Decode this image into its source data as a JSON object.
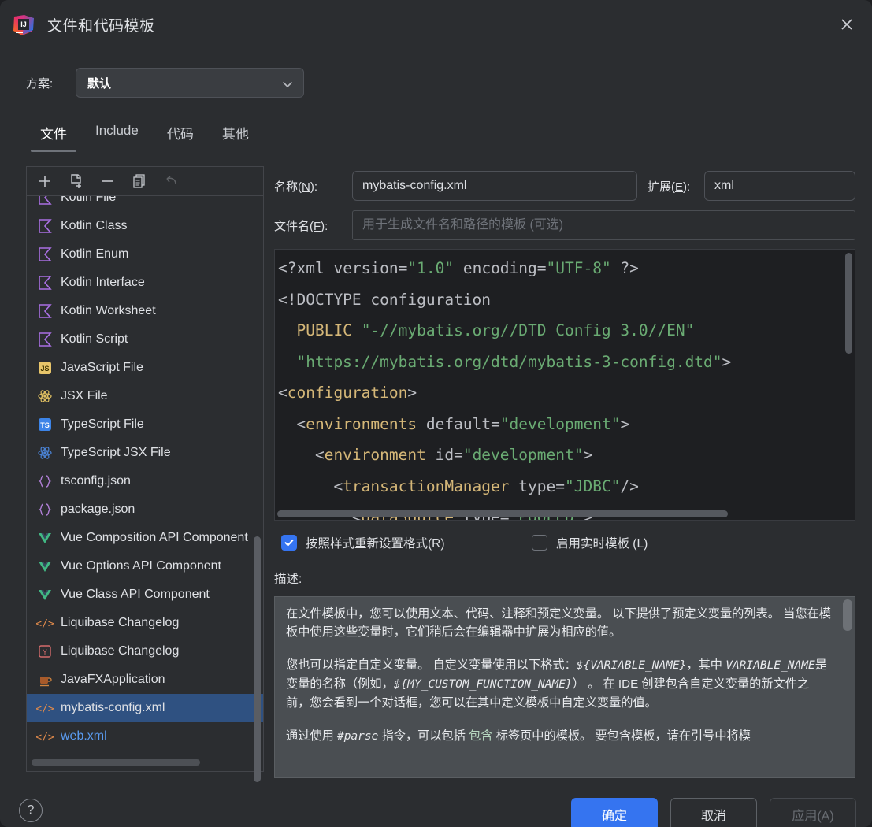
{
  "window": {
    "title": "文件和代码模板",
    "logo_icon": "intellij-idea-logo",
    "close_icon": "close-icon"
  },
  "scheme": {
    "label": "方案:",
    "value": "默认",
    "chevron_icon": "chevron-down-icon"
  },
  "tabs": [
    {
      "label": "文件",
      "active": true
    },
    {
      "label": "Include",
      "active": false
    },
    {
      "label": "代码",
      "active": false
    },
    {
      "label": "其他",
      "active": false
    }
  ],
  "list_toolbar": [
    {
      "name": "add-button",
      "icon": "plus-icon",
      "disabled": false
    },
    {
      "name": "create-template-button",
      "icon": "new-file-plus-icon",
      "disabled": false
    },
    {
      "name": "remove-button",
      "icon": "minus-icon",
      "disabled": false
    },
    {
      "name": "copy-button",
      "icon": "copy-icon",
      "disabled": false
    },
    {
      "name": "reset-button",
      "icon": "undo-icon",
      "disabled": true
    }
  ],
  "template_list": [
    {
      "label": "Kotlin File",
      "icon": "kotlin-icon",
      "selected": false,
      "modified": false
    },
    {
      "label": "Kotlin Class",
      "icon": "kotlin-icon",
      "selected": false,
      "modified": false
    },
    {
      "label": "Kotlin Enum",
      "icon": "kotlin-icon",
      "selected": false,
      "modified": false
    },
    {
      "label": "Kotlin Interface",
      "icon": "kotlin-icon",
      "selected": false,
      "modified": false
    },
    {
      "label": "Kotlin Worksheet",
      "icon": "kotlin-icon",
      "selected": false,
      "modified": false
    },
    {
      "label": "Kotlin Script",
      "icon": "kotlin-icon",
      "selected": false,
      "modified": false
    },
    {
      "label": "JavaScript File",
      "icon": "javascript-icon",
      "selected": false,
      "modified": false
    },
    {
      "label": "JSX File",
      "icon": "react-icon",
      "selected": false,
      "modified": false
    },
    {
      "label": "TypeScript File",
      "icon": "typescript-icon",
      "selected": false,
      "modified": false
    },
    {
      "label": "TypeScript JSX File",
      "icon": "react-ts-icon",
      "selected": false,
      "modified": false
    },
    {
      "label": "tsconfig.json",
      "icon": "json-icon",
      "selected": false,
      "modified": false
    },
    {
      "label": "package.json",
      "icon": "json-icon",
      "selected": false,
      "modified": false
    },
    {
      "label": "Vue Composition API Component",
      "icon": "vue-icon",
      "selected": false,
      "modified": false
    },
    {
      "label": "Vue Options API Component",
      "icon": "vue-icon",
      "selected": false,
      "modified": false
    },
    {
      "label": "Vue Class API Component",
      "icon": "vue-icon",
      "selected": false,
      "modified": false
    },
    {
      "label": "Liquibase Changelog",
      "icon": "xml-icon",
      "selected": false,
      "modified": false
    },
    {
      "label": "Liquibase Changelog",
      "icon": "yaml-icon",
      "selected": false,
      "modified": false
    },
    {
      "label": "JavaFXApplication",
      "icon": "java-icon",
      "selected": false,
      "modified": false
    },
    {
      "label": "mybatis-config.xml",
      "icon": "xml-icon",
      "selected": true,
      "modified": false
    },
    {
      "label": "web.xml",
      "icon": "xml-icon",
      "selected": false,
      "modified": true
    }
  ],
  "fields": {
    "name_label_pre": "名称(",
    "name_label_mn": "N",
    "name_label_post": "):",
    "name_value": "mybatis-config.xml",
    "ext_label_pre": "扩展(",
    "ext_label_mn": "E",
    "ext_label_post": "):",
    "ext_value": "xml",
    "filename_label_pre": "文件名(",
    "filename_label_mn": "F",
    "filename_label_post": "):",
    "filename_value": "",
    "filename_placeholder": "用于生成文件名和路径的模板 (可选)"
  },
  "editor": {
    "lines": [
      [
        {
          "t": "<?xml ",
          "c": "tg"
        },
        {
          "t": "version",
          "c": "at"
        },
        {
          "t": "=",
          "c": "tg"
        },
        {
          "t": "\"1.0\"",
          "c": "st"
        },
        {
          "t": " ",
          "c": "tg"
        },
        {
          "t": "encoding",
          "c": "at"
        },
        {
          "t": "=",
          "c": "tg"
        },
        {
          "t": "\"UTF-8\"",
          "c": "st"
        },
        {
          "t": " ?>",
          "c": "tg"
        }
      ],
      [
        {
          "t": "<!DOCTYPE configuration",
          "c": "tg"
        }
      ],
      [
        {
          "t": "  ",
          "c": "tg"
        },
        {
          "t": "PUBLIC",
          "c": "kw"
        },
        {
          "t": " ",
          "c": "tg"
        },
        {
          "t": "\"-//mybatis.org//DTD Config 3.0//EN\"",
          "c": "st"
        }
      ],
      [
        {
          "t": "  ",
          "c": "tg"
        },
        {
          "t": "\"https://mybatis.org/dtd/mybatis-3-config.dtd\"",
          "c": "st"
        },
        {
          "t": ">",
          "c": "tg"
        }
      ],
      [
        {
          "t": "<",
          "c": "tg"
        },
        {
          "t": "configuration",
          "c": "tn"
        },
        {
          "t": ">",
          "c": "tg"
        }
      ],
      [
        {
          "t": "  <",
          "c": "tg"
        },
        {
          "t": "environments",
          "c": "tn"
        },
        {
          "t": " ",
          "c": "tg"
        },
        {
          "t": "default",
          "c": "at"
        },
        {
          "t": "=",
          "c": "tg"
        },
        {
          "t": "\"development\"",
          "c": "st"
        },
        {
          "t": ">",
          "c": "tg"
        }
      ],
      [
        {
          "t": "    <",
          "c": "tg"
        },
        {
          "t": "environment",
          "c": "tn"
        },
        {
          "t": " ",
          "c": "tg"
        },
        {
          "t": "id",
          "c": "at"
        },
        {
          "t": "=",
          "c": "tg"
        },
        {
          "t": "\"development\"",
          "c": "st"
        },
        {
          "t": ">",
          "c": "tg"
        }
      ],
      [
        {
          "t": "      <",
          "c": "tg"
        },
        {
          "t": "transactionManager",
          "c": "tn"
        },
        {
          "t": " ",
          "c": "tg"
        },
        {
          "t": "type",
          "c": "at"
        },
        {
          "t": "=",
          "c": "tg"
        },
        {
          "t": "\"JDBC\"",
          "c": "st"
        },
        {
          "t": "/>",
          "c": "tg"
        }
      ],
      [
        {
          "t": "        <",
          "c": "tg"
        },
        {
          "t": "dataSource",
          "c": "tn"
        },
        {
          "t": " ",
          "c": "tg"
        },
        {
          "t": "type",
          "c": "at"
        },
        {
          "t": "=",
          "c": "tg"
        },
        {
          "t": "\"POOLED\"",
          "c": "st"
        },
        {
          "t": ">",
          "c": "tg"
        }
      ]
    ]
  },
  "options": {
    "reformat_label": "按照样式重新设置格式(R)",
    "reformat_checked": true,
    "live_template_label": "启用实时模板 (L)",
    "live_template_checked": false
  },
  "description": {
    "label": "描述:",
    "p1_a": "在文件模板中，您可以使用文本、代码、注释和预定义变量。 以下提供了预定义变量的列表。 当您在模板中使用这些变量时，它们稍后会在编辑器中扩展为相应的值。",
    "p2_a": "您也可以指定自定义变量。 自定义变量使用以下格式：",
    "p2_var1": "${VARIABLE_NAME}",
    "p2_b": "，其中 ",
    "p2_var2": "VARIABLE_NAME",
    "p2_c": "是变量的名称（例如，",
    "p2_var3": "${MY_CUSTOM_FUNCTION_NAME}",
    "p2_d": "） 。 在 IDE 创建包含自定义变量的新文件之前，您会看到一个对话框，您可以在其中定义模板中自定义变量的值。",
    "p3_a": "通过使用 ",
    "p3_var1": "#parse",
    "p3_b": " 指令，可以包括 ",
    "p3_link": "包含",
    "p3_c": " 标签页中的模板。 要包含模板，请在引号中将模"
  },
  "footer": {
    "help_label": "?",
    "ok_label": "确定",
    "cancel_label": "取消",
    "apply_label": "应用(A)"
  },
  "colors": {
    "accent": "#3574f0",
    "selection": "#2f5181",
    "dialog_bg": "#2b2d30",
    "editor_bg": "#1e1f22",
    "desc_bg": "#4a4e52"
  }
}
